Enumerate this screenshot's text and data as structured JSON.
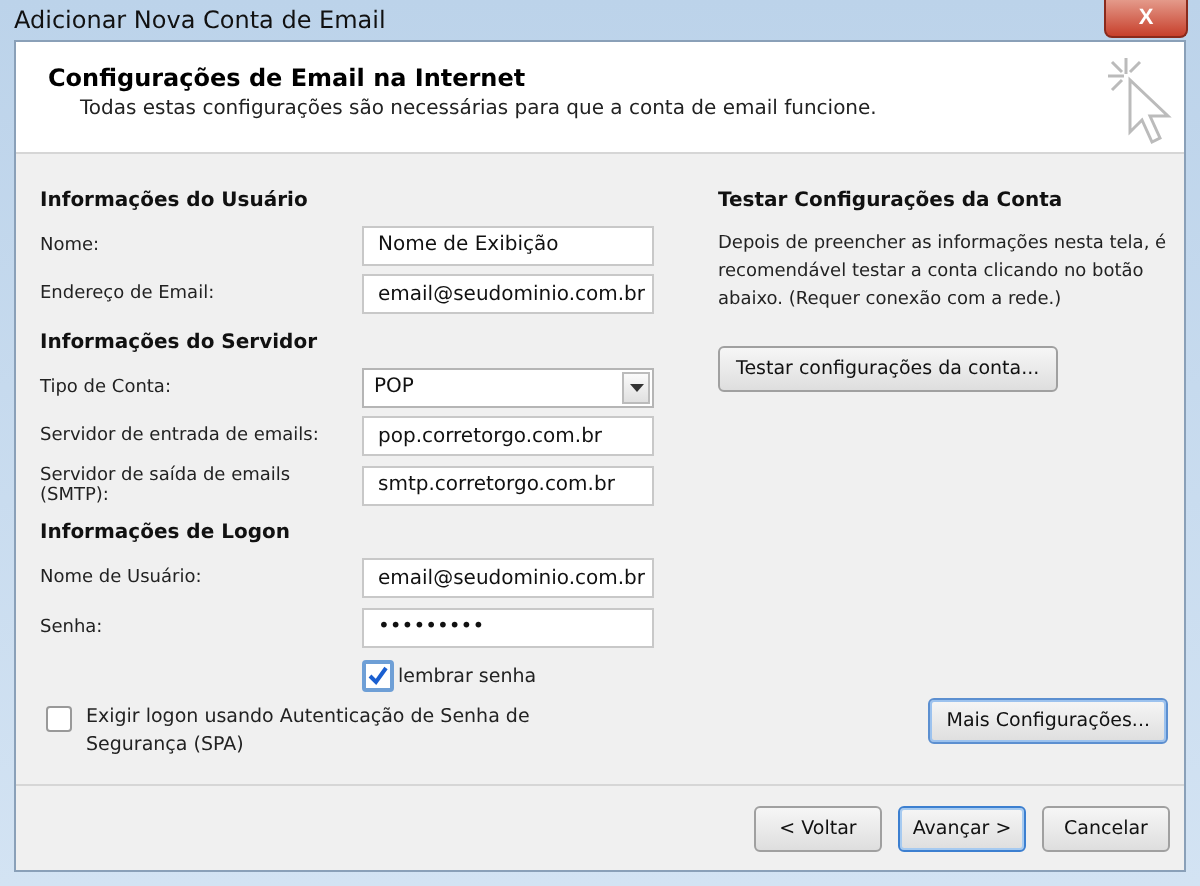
{
  "window": {
    "title": "Adicionar Nova Conta de Email",
    "close": "X"
  },
  "header": {
    "title": "Configurações de Email na Internet",
    "subtitle": "Todas estas configurações são necessárias para que a conta de email funcione."
  },
  "sections": [
    {
      "heading": "Informações do Usuário",
      "fields": [
        {
          "label": "Nome:",
          "value": "Nome de Exibição",
          "kind": "text"
        },
        {
          "label": "Endereço de Email:",
          "value": "email@seudominio.com.br",
          "kind": "text"
        }
      ]
    },
    {
      "heading": "Informações do Servidor",
      "fields": [
        {
          "label": "Tipo de Conta:",
          "value": "POP",
          "kind": "select"
        },
        {
          "label": "Servidor de entrada de emails:",
          "value": "pop.corretorgo.com.br",
          "kind": "text"
        },
        {
          "label": "Servidor de saída de emails (SMTP):",
          "value": "smtp.corretorgo.com.br",
          "kind": "text"
        }
      ]
    },
    {
      "heading": "Informações de Logon",
      "fields": [
        {
          "label": "Nome de Usuário:",
          "value": "email@seudominio.com.br",
          "kind": "text"
        },
        {
          "label": "Senha:",
          "value": "•••••••••",
          "kind": "password"
        }
      ]
    }
  ],
  "remember": {
    "label": "lembrar senha",
    "checked": true
  },
  "spa": {
    "label": "Exigir logon usando Autenticação de Senha de Segurança (SPA)",
    "checked": false
  },
  "test": {
    "heading": "Testar Configurações da Conta",
    "text": "Depois de preencher as informações nesta tela, é recomendável testar a conta clicando no botão abaixo. (Requer conexão com a rede.)",
    "button": "Testar configurações da conta..."
  },
  "more_button": "Mais Configurações...",
  "footer_buttons": [
    {
      "label": "< Voltar",
      "selected": false
    },
    {
      "label": "Avançar >",
      "selected": true
    },
    {
      "label": "Cancelar",
      "selected": false
    }
  ]
}
